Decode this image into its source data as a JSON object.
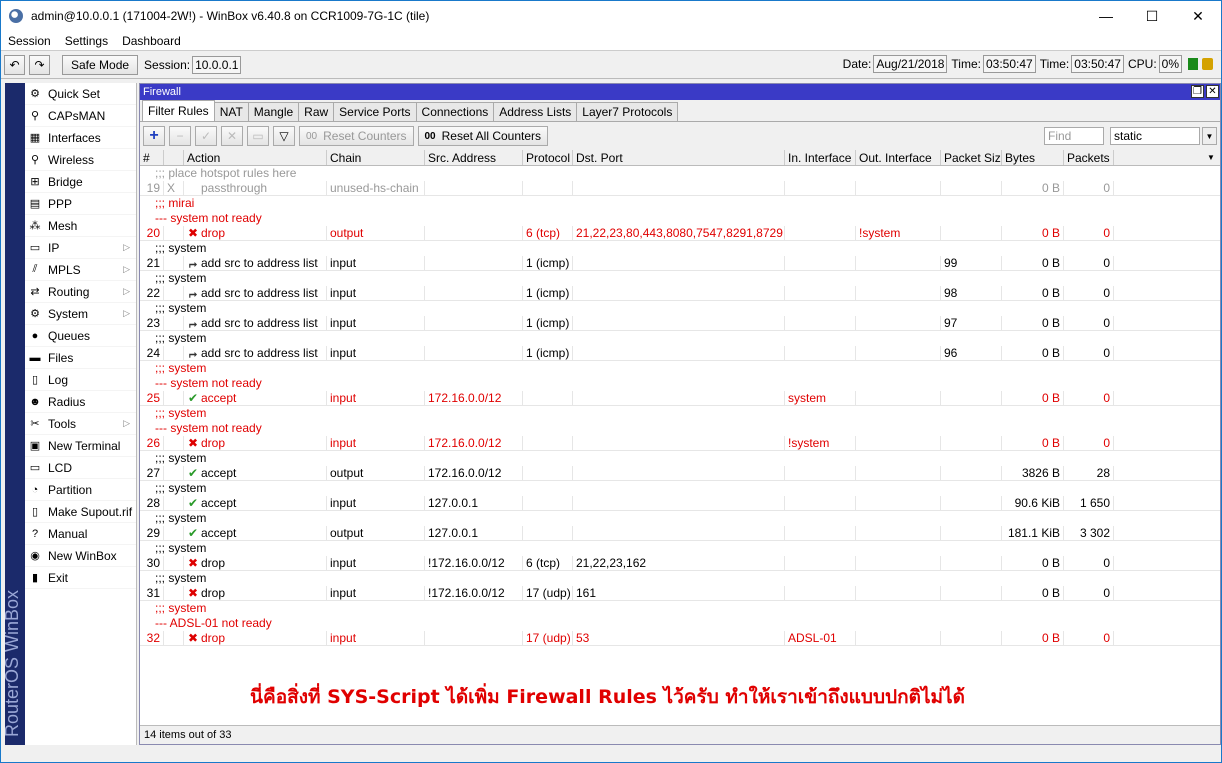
{
  "window": {
    "title": "admin@10.0.0.1 (171004-2W!) - WinBox v6.40.8 on CCR1009-7G-1C (tile)",
    "min": "—",
    "max": "☐",
    "close": "✕"
  },
  "menu": [
    "Session",
    "Settings",
    "Dashboard"
  ],
  "toolbar": {
    "safe_mode": "Safe Mode",
    "session_label": "Session:",
    "session_value": "10.0.0.1",
    "date_label": "Date:",
    "date_value": "Aug/21/2018",
    "time_label": "Time:",
    "time_value": "03:50:47",
    "time2_label": "Time:",
    "time2_value": "03:50:47",
    "cpu_label": "CPU:",
    "cpu_value": "0%"
  },
  "brand": "RouterOS WinBox",
  "sidebar": [
    {
      "label": "Quick Set",
      "icon": "quick-set-icon",
      "glyph": "⚙",
      "arrow": false
    },
    {
      "label": "CAPsMAN",
      "icon": "capsman-icon",
      "glyph": "⚲",
      "arrow": false
    },
    {
      "label": "Interfaces",
      "icon": "interfaces-icon",
      "glyph": "▦",
      "arrow": false
    },
    {
      "label": "Wireless",
      "icon": "wireless-icon",
      "glyph": "⚲",
      "arrow": false
    },
    {
      "label": "Bridge",
      "icon": "bridge-icon",
      "glyph": "⊞",
      "arrow": false
    },
    {
      "label": "PPP",
      "icon": "ppp-icon",
      "glyph": "▤",
      "arrow": false
    },
    {
      "label": "Mesh",
      "icon": "mesh-icon",
      "glyph": "⁂",
      "arrow": false
    },
    {
      "label": "IP",
      "icon": "ip-icon",
      "glyph": "▭",
      "arrow": true
    },
    {
      "label": "MPLS",
      "icon": "mpls-icon",
      "glyph": "⫽",
      "arrow": true
    },
    {
      "label": "Routing",
      "icon": "routing-icon",
      "glyph": "⇄",
      "arrow": true
    },
    {
      "label": "System",
      "icon": "system-icon",
      "glyph": "⚙",
      "arrow": true
    },
    {
      "label": "Queues",
      "icon": "queues-icon",
      "glyph": "●",
      "arrow": false
    },
    {
      "label": "Files",
      "icon": "files-icon",
      "glyph": "▬",
      "arrow": false
    },
    {
      "label": "Log",
      "icon": "log-icon",
      "glyph": "▯",
      "arrow": false
    },
    {
      "label": "Radius",
      "icon": "radius-icon",
      "glyph": "☻",
      "arrow": false
    },
    {
      "label": "Tools",
      "icon": "tools-icon",
      "glyph": "✂",
      "arrow": true
    },
    {
      "label": "New Terminal",
      "icon": "terminal-icon",
      "glyph": "▣",
      "arrow": false
    },
    {
      "label": "LCD",
      "icon": "lcd-icon",
      "glyph": "▭",
      "arrow": false
    },
    {
      "label": "Partition",
      "icon": "partition-icon",
      "glyph": "◔",
      "arrow": false
    },
    {
      "label": "Make Supout.rif",
      "icon": "supout-icon",
      "glyph": "▯",
      "arrow": false
    },
    {
      "label": "Manual",
      "icon": "manual-icon",
      "glyph": "?",
      "arrow": false
    },
    {
      "label": "New WinBox",
      "icon": "winbox-icon",
      "glyph": "◉",
      "arrow": false
    },
    {
      "label": "Exit",
      "icon": "exit-icon",
      "glyph": "▮",
      "arrow": false
    }
  ],
  "firewall": {
    "title": "Firewall",
    "tabs": [
      "Filter Rules",
      "NAT",
      "Mangle",
      "Raw",
      "Service Ports",
      "Connections",
      "Address Lists",
      "Layer7 Protocols"
    ],
    "reset_counters": "Reset Counters",
    "reset_all_counters": "Reset All Counters",
    "counter_prefix": "00",
    "find_placeholder": "Find",
    "filter_value": "static",
    "columns": [
      "#",
      "",
      "Action",
      "Chain",
      "Src. Address",
      "Protocol",
      "Dst. Port",
      "In. Interface",
      "Out. Interface",
      "Packet Size",
      "Bytes",
      "Packets"
    ],
    "rows": [
      {
        "type": "comment",
        "text": ";;; place hotspot rules here",
        "style": "disabled"
      },
      {
        "type": "data",
        "style": "disabled",
        "num": "19",
        "flag": "X",
        "icon": "",
        "action": "passthrough",
        "chain": "unused-hs-chain",
        "src": "",
        "proto": "",
        "dst": "",
        "in": "",
        "out": "",
        "psize": "",
        "bytes": "0 B",
        "packets": "0"
      },
      {
        "type": "comment",
        "text": ";;; mirai",
        "style": "red"
      },
      {
        "type": "comment",
        "text": "--- system not ready",
        "style": "red"
      },
      {
        "type": "data",
        "style": "red",
        "num": "20",
        "flag": "",
        "icon": "drop",
        "action": "drop",
        "chain": "output",
        "src": "",
        "proto": "6 (tcp)",
        "dst": "21,22,23,80,443,8080,7547,8291,8729",
        "in": "",
        "out": "!system",
        "psize": "",
        "bytes": "0 B",
        "packets": "0"
      },
      {
        "type": "comment",
        "text": ";;; system",
        "style": "normal"
      },
      {
        "type": "data",
        "style": "normal",
        "num": "21",
        "flag": "",
        "icon": "add",
        "action": "add src to address list",
        "chain": "input",
        "src": "",
        "proto": "1 (icmp)",
        "dst": "",
        "in": "",
        "out": "",
        "psize": "99",
        "bytes": "0 B",
        "packets": "0"
      },
      {
        "type": "comment",
        "text": ";;; system",
        "style": "normal"
      },
      {
        "type": "data",
        "style": "normal",
        "num": "22",
        "flag": "",
        "icon": "add",
        "action": "add src to address list",
        "chain": "input",
        "src": "",
        "proto": "1 (icmp)",
        "dst": "",
        "in": "",
        "out": "",
        "psize": "98",
        "bytes": "0 B",
        "packets": "0"
      },
      {
        "type": "comment",
        "text": ";;; system",
        "style": "normal"
      },
      {
        "type": "data",
        "style": "normal",
        "num": "23",
        "flag": "",
        "icon": "add",
        "action": "add src to address list",
        "chain": "input",
        "src": "",
        "proto": "1 (icmp)",
        "dst": "",
        "in": "",
        "out": "",
        "psize": "97",
        "bytes": "0 B",
        "packets": "0"
      },
      {
        "type": "comment",
        "text": ";;; system",
        "style": "normal"
      },
      {
        "type": "data",
        "style": "normal",
        "num": "24",
        "flag": "",
        "icon": "add",
        "action": "add src to address list",
        "chain": "input",
        "src": "",
        "proto": "1 (icmp)",
        "dst": "",
        "in": "",
        "out": "",
        "psize": "96",
        "bytes": "0 B",
        "packets": "0"
      },
      {
        "type": "comment",
        "text": ";;; system",
        "style": "red"
      },
      {
        "type": "comment",
        "text": "--- system not ready",
        "style": "red"
      },
      {
        "type": "data",
        "style": "red",
        "num": "25",
        "flag": "",
        "icon": "accept",
        "action": "accept",
        "chain": "input",
        "src": "172.16.0.0/12",
        "proto": "",
        "dst": "",
        "in": "system",
        "out": "",
        "psize": "",
        "bytes": "0 B",
        "packets": "0"
      },
      {
        "type": "comment",
        "text": ";;; system",
        "style": "red"
      },
      {
        "type": "comment",
        "text": "--- system not ready",
        "style": "red"
      },
      {
        "type": "data",
        "style": "red",
        "num": "26",
        "flag": "",
        "icon": "drop",
        "action": "drop",
        "chain": "input",
        "src": "172.16.0.0/12",
        "proto": "",
        "dst": "",
        "in": "!system",
        "out": "",
        "psize": "",
        "bytes": "0 B",
        "packets": "0"
      },
      {
        "type": "comment",
        "text": ";;; system",
        "style": "normal"
      },
      {
        "type": "data",
        "style": "normal",
        "num": "27",
        "flag": "",
        "icon": "accept",
        "action": "accept",
        "chain": "output",
        "src": "172.16.0.0/12",
        "proto": "",
        "dst": "",
        "in": "",
        "out": "",
        "psize": "",
        "bytes": "3826 B",
        "packets": "28"
      },
      {
        "type": "comment",
        "text": ";;; system",
        "style": "normal"
      },
      {
        "type": "data",
        "style": "normal",
        "num": "28",
        "flag": "",
        "icon": "accept",
        "action": "accept",
        "chain": "input",
        "src": "127.0.0.1",
        "proto": "",
        "dst": "",
        "in": "",
        "out": "",
        "psize": "",
        "bytes": "90.6 KiB",
        "packets": "1 650"
      },
      {
        "type": "comment",
        "text": ";;; system",
        "style": "normal"
      },
      {
        "type": "data",
        "style": "normal",
        "num": "29",
        "flag": "",
        "icon": "accept",
        "action": "accept",
        "chain": "output",
        "src": "127.0.0.1",
        "proto": "",
        "dst": "",
        "in": "",
        "out": "",
        "psize": "",
        "bytes": "181.1 KiB",
        "packets": "3 302"
      },
      {
        "type": "comment",
        "text": ";;; system",
        "style": "normal"
      },
      {
        "type": "data",
        "style": "normal",
        "num": "30",
        "flag": "",
        "icon": "drop",
        "action": "drop",
        "chain": "input",
        "src": "!172.16.0.0/12",
        "proto": "6 (tcp)",
        "dst": "21,22,23,162",
        "in": "",
        "out": "",
        "psize": "",
        "bytes": "0 B",
        "packets": "0"
      },
      {
        "type": "comment",
        "text": ";;; system",
        "style": "normal"
      },
      {
        "type": "data",
        "style": "normal",
        "num": "31",
        "flag": "",
        "icon": "drop",
        "action": "drop",
        "chain": "input",
        "src": "!172.16.0.0/12",
        "proto": "17 (udp)",
        "dst": "161",
        "in": "",
        "out": "",
        "psize": "",
        "bytes": "0 B",
        "packets": "0"
      },
      {
        "type": "comment",
        "text": ";;; system",
        "style": "red"
      },
      {
        "type": "comment",
        "text": "--- ADSL-01 not ready",
        "style": "red"
      },
      {
        "type": "data",
        "style": "red",
        "num": "32",
        "flag": "",
        "icon": "drop",
        "action": "drop",
        "chain": "input",
        "src": "",
        "proto": "17 (udp)",
        "dst": "53",
        "in": "ADSL-01",
        "out": "",
        "psize": "",
        "bytes": "0 B",
        "packets": "0"
      }
    ],
    "note": "นี่คือสิ่งที่ SYS-Script ได้เพิ่ม Firewall Rules ไว้ครับ ทำให้เราเข้าถึงแบบปกติไม่ได้",
    "status": "14 items out of 33"
  }
}
